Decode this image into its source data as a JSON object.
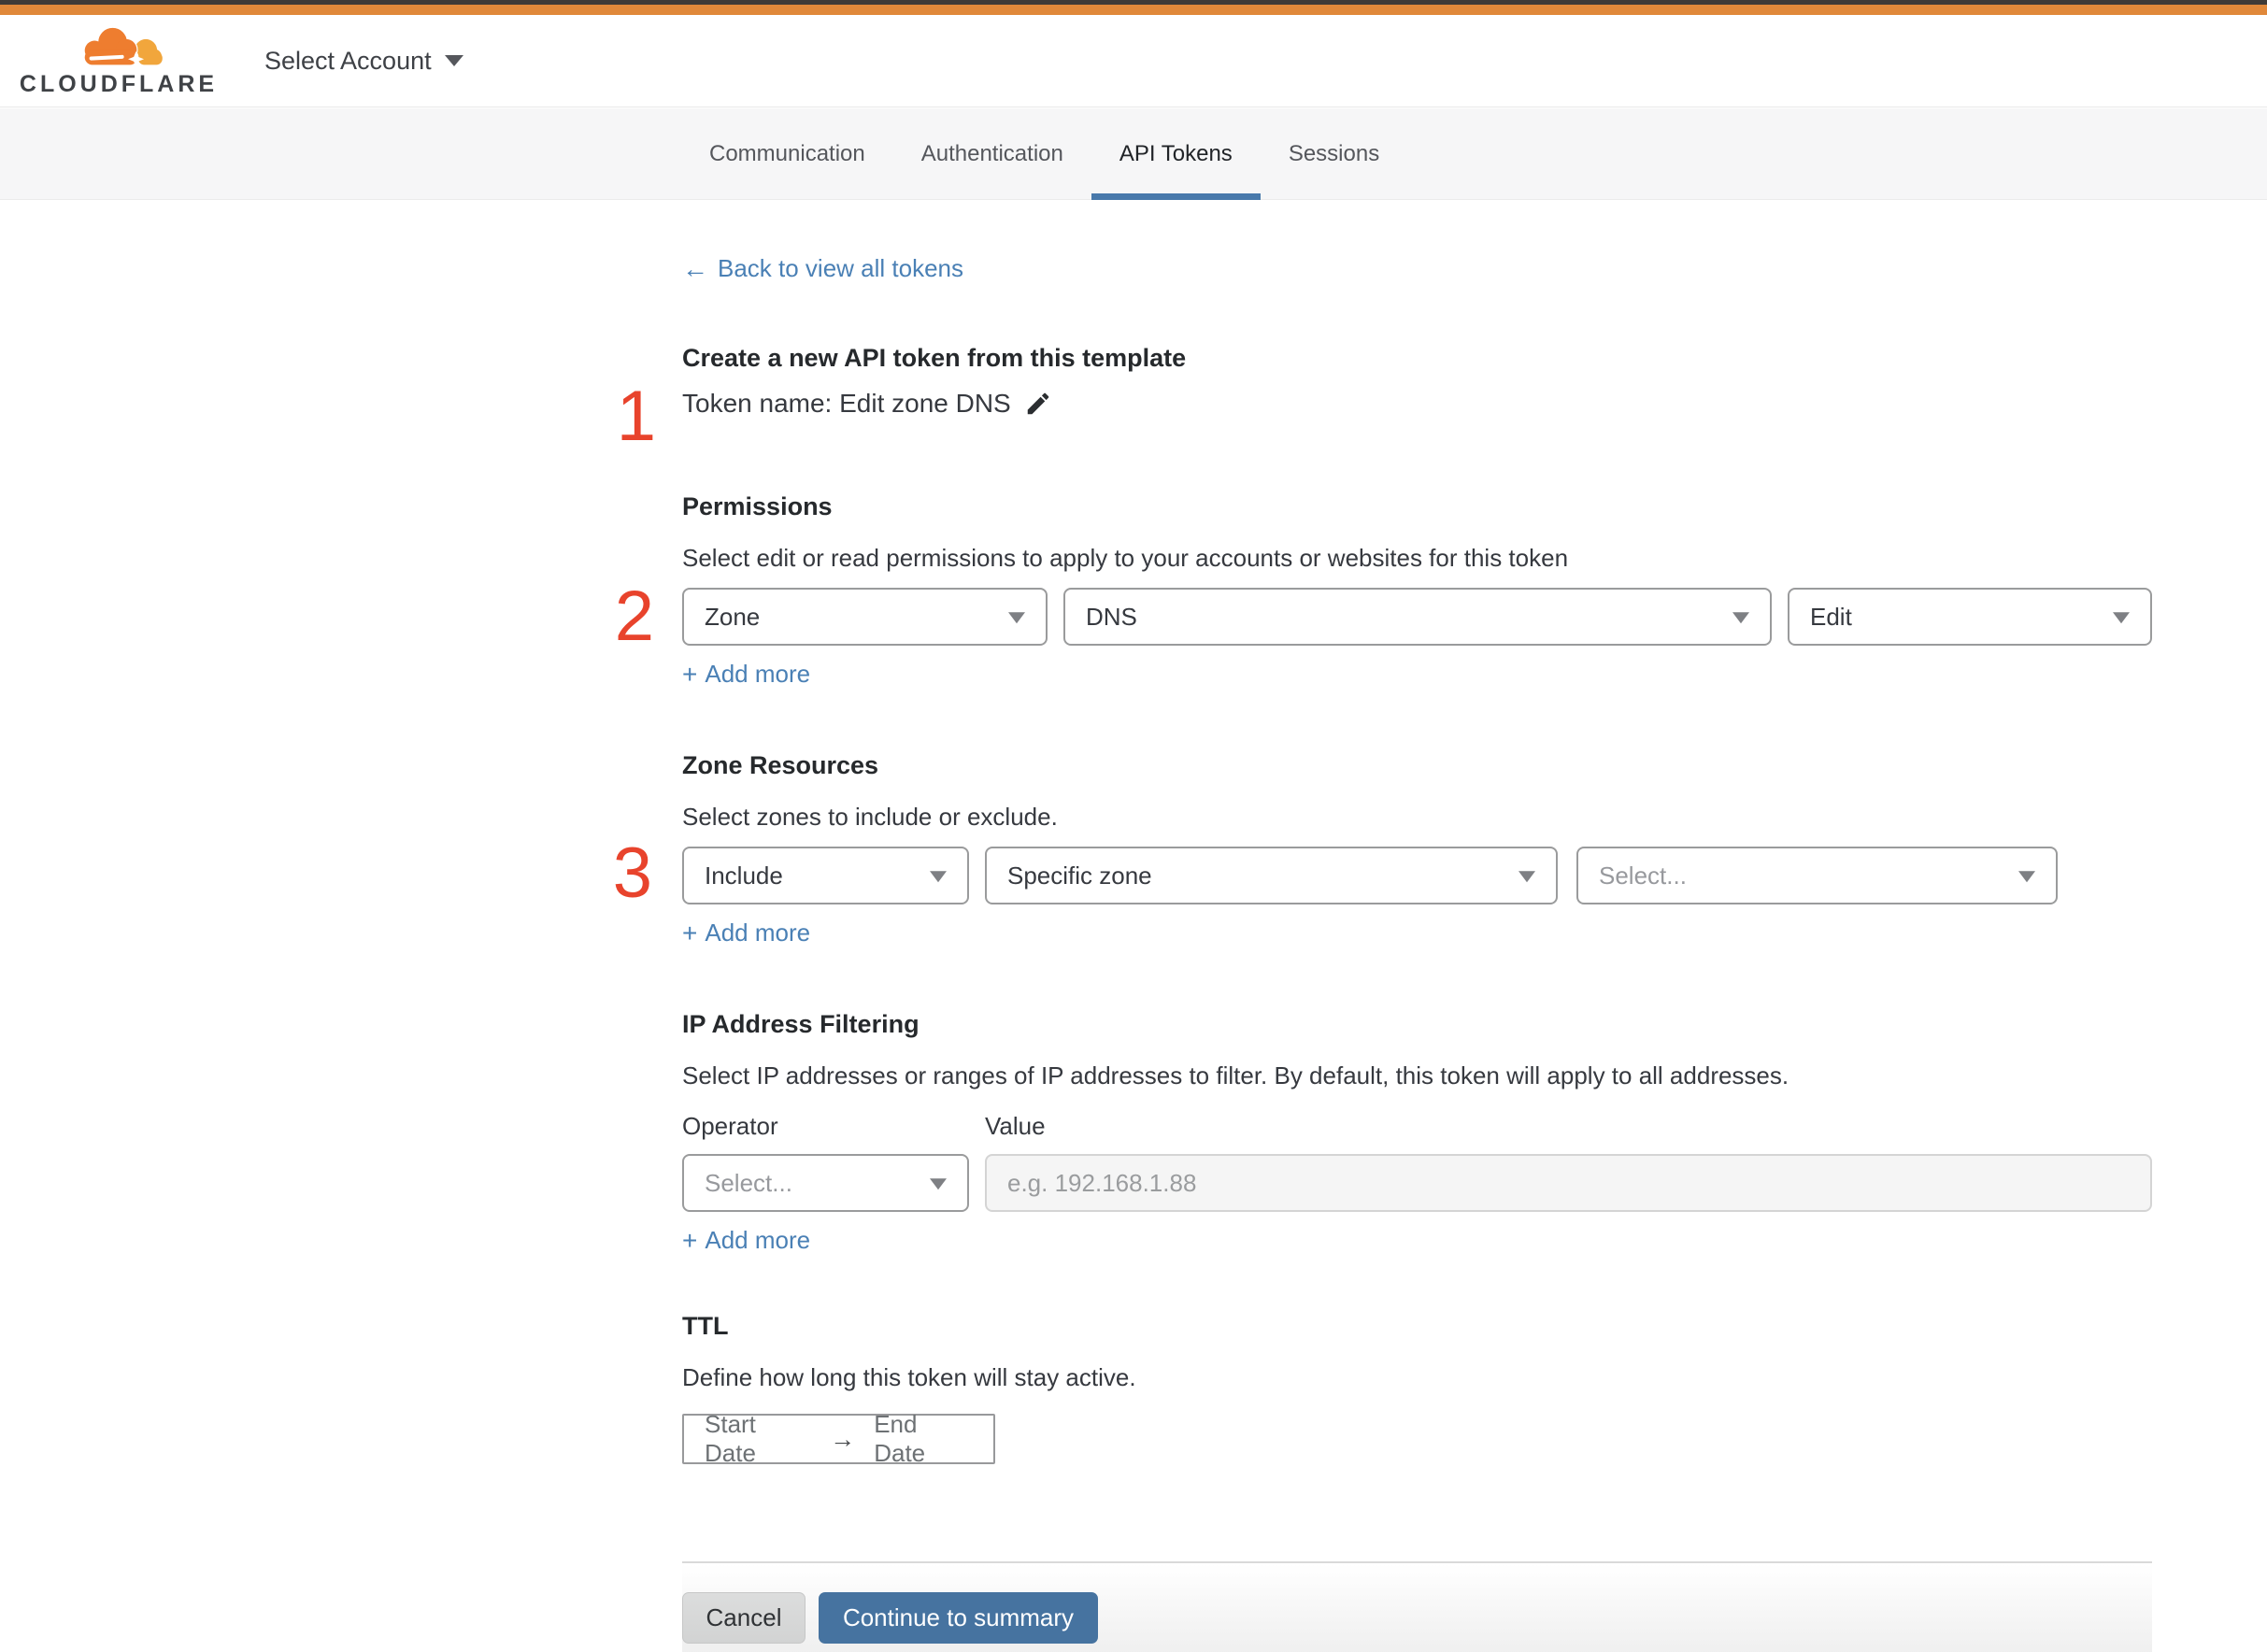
{
  "brand": {
    "name": "CLOUDFLARE"
  },
  "header": {
    "account_selector_label": "Select Account"
  },
  "tabs": [
    {
      "label": "Communication"
    },
    {
      "label": "Authentication"
    },
    {
      "label": "API Tokens"
    },
    {
      "label": "Sessions"
    }
  ],
  "back_link": {
    "arrow": "←",
    "label": "Back to view all tokens"
  },
  "steps": {
    "one": "1",
    "two": "2",
    "three": "3"
  },
  "token_template": {
    "title": "Create a new API token from this template",
    "token_name": "Token name: Edit zone DNS"
  },
  "permissions": {
    "title": "Permissions",
    "description": "Select edit or read permissions to apply to your accounts or websites for this token",
    "scope_select": "Zone",
    "service_select": "DNS",
    "access_select": "Edit",
    "plus": "+",
    "add_more": "Add more"
  },
  "zone_resources": {
    "title": "Zone Resources",
    "description": "Select zones to include or exclude.",
    "mode_select": "Include",
    "type_select": "Specific zone",
    "zone_select_placeholder": "Select...",
    "plus": "+",
    "add_more": "Add more"
  },
  "ip_filtering": {
    "title": "IP Address Filtering",
    "description": "Select IP addresses or ranges of IP addresses to filter. By default, this token will apply to all addresses.",
    "operator_label": "Operator",
    "value_label": "Value",
    "operator_placeholder": "Select...",
    "value_placeholder": "e.g. 192.168.1.88",
    "plus": "+",
    "add_more": "Add more"
  },
  "ttl": {
    "title": "TTL",
    "description": "Define how long this token will stay active.",
    "start_date_placeholder": "Start Date",
    "range_arrow": "→",
    "end_date_placeholder": "End Date"
  },
  "footer": {
    "cancel_label": "Cancel",
    "continue_label": "Continue to summary"
  },
  "colors": {
    "accent_orange": "#e0883a",
    "step_red": "#e8432c",
    "link_blue": "#4a80b5",
    "button_blue": "#4673a0",
    "tab_underline_blue": "#4879ab"
  }
}
